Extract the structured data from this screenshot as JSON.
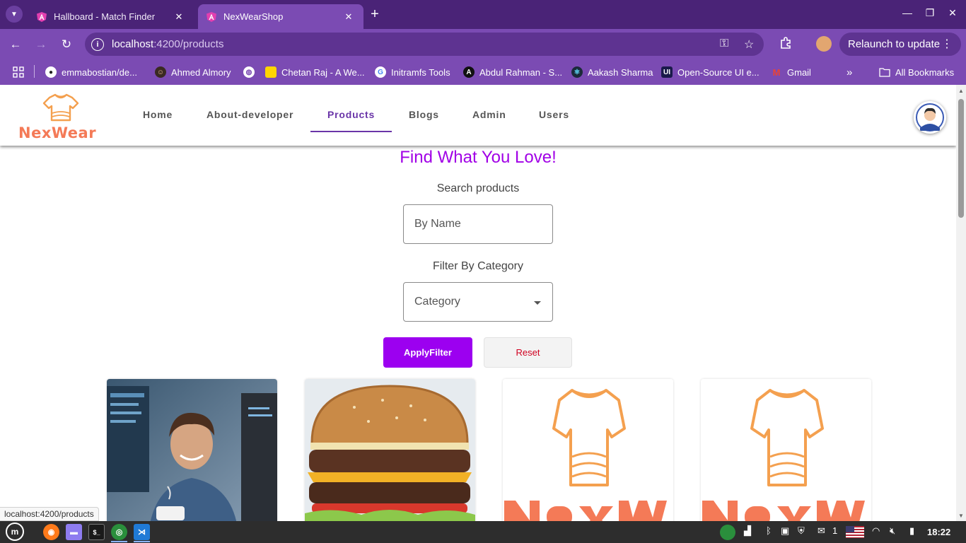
{
  "browser": {
    "tabs": [
      {
        "title": "Hallboard - Match Finder",
        "active": false
      },
      {
        "title": "NexWearShop",
        "active": true
      }
    ],
    "url_host": "localhost",
    "url_path": ":4200/products",
    "relaunch_label": "Relaunch to update",
    "bookmarks": [
      {
        "label": "emmabostian/de...",
        "icon": "github-icon"
      },
      {
        "label": "Ahmed Almory",
        "icon": "person-icon"
      },
      {
        "label": "",
        "icon": "globe-icon"
      },
      {
        "label": "Chetan Raj - A We...",
        "icon": "yellow-square-icon"
      },
      {
        "label": "Initramfs Tools",
        "icon": "google-icon"
      },
      {
        "label": "Abdul Rahman - S...",
        "icon": "a-logo-icon"
      },
      {
        "label": "Aakash Sharma",
        "icon": "react-icon"
      },
      {
        "label": "Open-Source UI e...",
        "icon": "ui-logo-icon"
      },
      {
        "label": "Gmail",
        "icon": "gmail-icon"
      }
    ],
    "all_bookmarks_label": "All Bookmarks",
    "status_url": "localhost:4200/products"
  },
  "app": {
    "logo_text": "NexWear",
    "nav": [
      {
        "label": "Home",
        "active": false
      },
      {
        "label": "About-developer",
        "active": false
      },
      {
        "label": "Products",
        "active": true
      },
      {
        "label": "Blogs",
        "active": false
      },
      {
        "label": "Admin",
        "active": false
      },
      {
        "label": "Users",
        "active": false
      }
    ],
    "headline": "Find What You Love!",
    "search_label": "Search products",
    "search_placeholder": "By Name",
    "filter_label": "Filter By Category",
    "category_placeholder": "Category",
    "apply_label": "ApplyFilter",
    "reset_label": "Reset",
    "products": [
      {
        "image": "developer-photo"
      },
      {
        "image": "burger-photo"
      },
      {
        "image": "nexwear-logo"
      },
      {
        "image": "nexwear-logo"
      }
    ],
    "accent_color": "#a100e6",
    "nav_active_color": "#6a35a8",
    "apply_color": "#9c00f0",
    "reset_text_color": "#d00020",
    "logo_color": "#f47a57"
  },
  "taskbar": {
    "apps": [
      "mint-menu-icon",
      "firefox-icon",
      "files-icon",
      "terminal-icon",
      "chrome-icon",
      "vscode-icon"
    ],
    "notification_count": "1",
    "clock": "18:22"
  }
}
